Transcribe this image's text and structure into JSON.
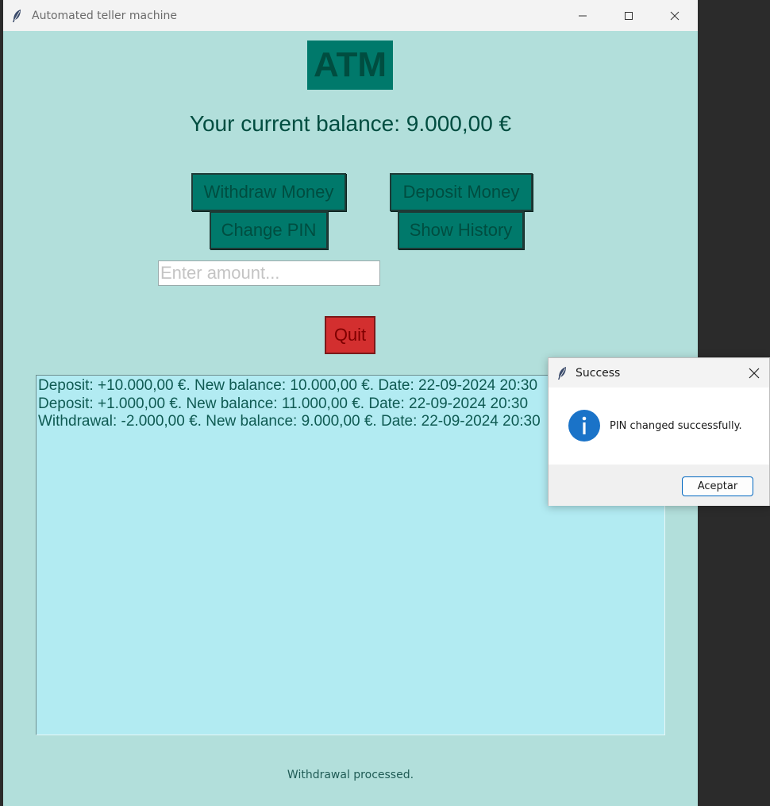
{
  "window": {
    "title": "Automated teller machine"
  },
  "app": {
    "heading": "ATM",
    "balance_text": "Your current balance: 9.000,00 €",
    "buttons": {
      "withdraw": "Withdraw Money",
      "deposit": "Deposit Money",
      "change_pin": "Change PIN",
      "show_history": "Show History",
      "quit": "Quit"
    },
    "amount_input": {
      "placeholder": "Enter amount...",
      "value": ""
    },
    "history": [
      "Deposit: +10.000,00 €. New balance: 10.000,00 €. Date: 22-09-2024 20:30",
      "Deposit: +1.000,00 €. New balance: 11.000,00 €. Date: 22-09-2024 20:30",
      "Withdrawal: -2.000,00 €. New balance: 9.000,00 €. Date: 22-09-2024 20:30"
    ],
    "status": "Withdrawal processed."
  },
  "dialog": {
    "title": "Success",
    "message": "PIN changed successfully.",
    "ok_label": "Aceptar",
    "icon": "info-icon"
  },
  "colors": {
    "window_bg": "#b2dfdb",
    "button_bg": "#00796b",
    "button_text": "#004d40",
    "quit_bg": "#d32f2f",
    "history_bg": "#b2ebf2"
  }
}
